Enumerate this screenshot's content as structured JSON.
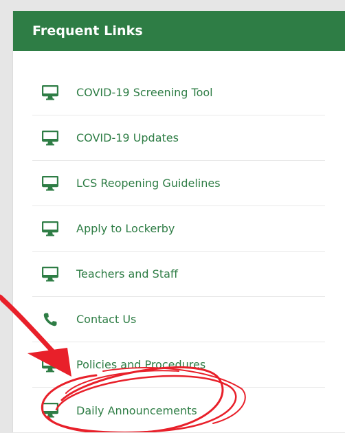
{
  "panel": {
    "title": "Frequent Links",
    "accent_color": "#2e7d45",
    "links": [
      {
        "label": "COVID-19 Screening Tool",
        "icon": "monitor-icon"
      },
      {
        "label": "COVID-19 Updates",
        "icon": "monitor-icon"
      },
      {
        "label": "LCS Reopening Guidelines",
        "icon": "monitor-icon"
      },
      {
        "label": "Apply to Lockerby",
        "icon": "monitor-icon"
      },
      {
        "label": "Teachers and Staff",
        "icon": "monitor-icon"
      },
      {
        "label": "Contact Us",
        "icon": "phone-icon"
      },
      {
        "label": "Policies and Procedures",
        "icon": "monitor-icon"
      },
      {
        "label": "Daily Announcements",
        "icon": "monitor-icon"
      }
    ]
  },
  "annotation": {
    "color": "#e8202a",
    "shapes": [
      "arrow",
      "circle"
    ]
  }
}
